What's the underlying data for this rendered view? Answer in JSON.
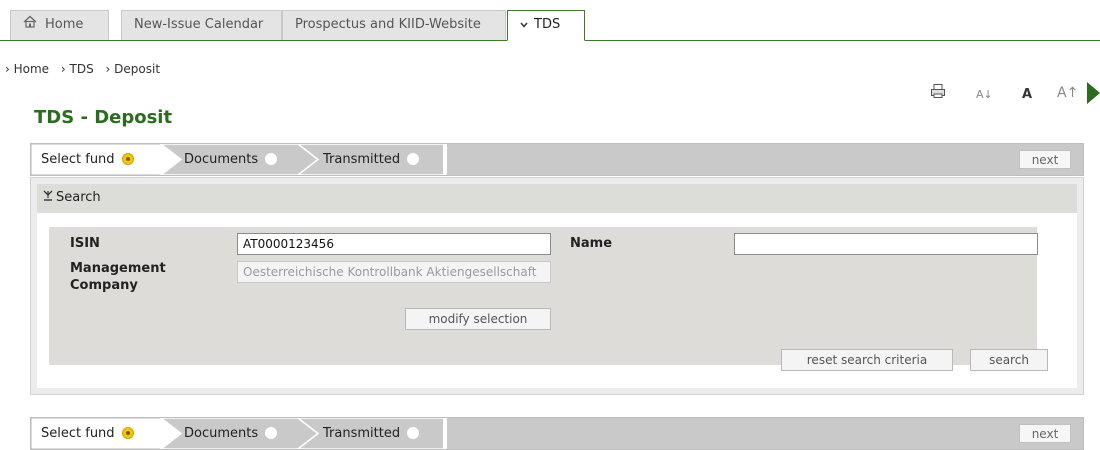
{
  "topnav": {
    "tabs": [
      {
        "label": "Home",
        "icon": "home-icon"
      },
      {
        "label": "New-Issue Calendar"
      },
      {
        "label": "Prospectus and KIID-Website"
      },
      {
        "label": "TDS",
        "icon": "chevron-down-icon",
        "active": true
      }
    ],
    "accent_color": "#3d7a2e"
  },
  "breadcrumb": [
    "Home",
    "TDS",
    "Deposit"
  ],
  "toolbar": {
    "print_icon": "print-icon",
    "font_smaller": "A↓",
    "font_normal": "A",
    "font_larger": "A↑"
  },
  "page_title": "TDS - Deposit",
  "steps": {
    "items": [
      {
        "label": "Select fund",
        "state": "active"
      },
      {
        "label": "Documents",
        "state": "inactive"
      },
      {
        "label": "Transmitted",
        "state": "inactive"
      }
    ],
    "next_label": "next"
  },
  "search": {
    "header": "Search",
    "isin_label": "ISIN",
    "isin_value": "AT0000123456",
    "name_label": "Name",
    "name_value": "",
    "management_label_line1": "Management",
    "management_label_line2": "Company",
    "management_value": "Oesterreichische Kontrollbank Aktiengesellschaft",
    "modify_label": "modify selection",
    "reset_label": "reset search criteria",
    "search_label": "search"
  }
}
